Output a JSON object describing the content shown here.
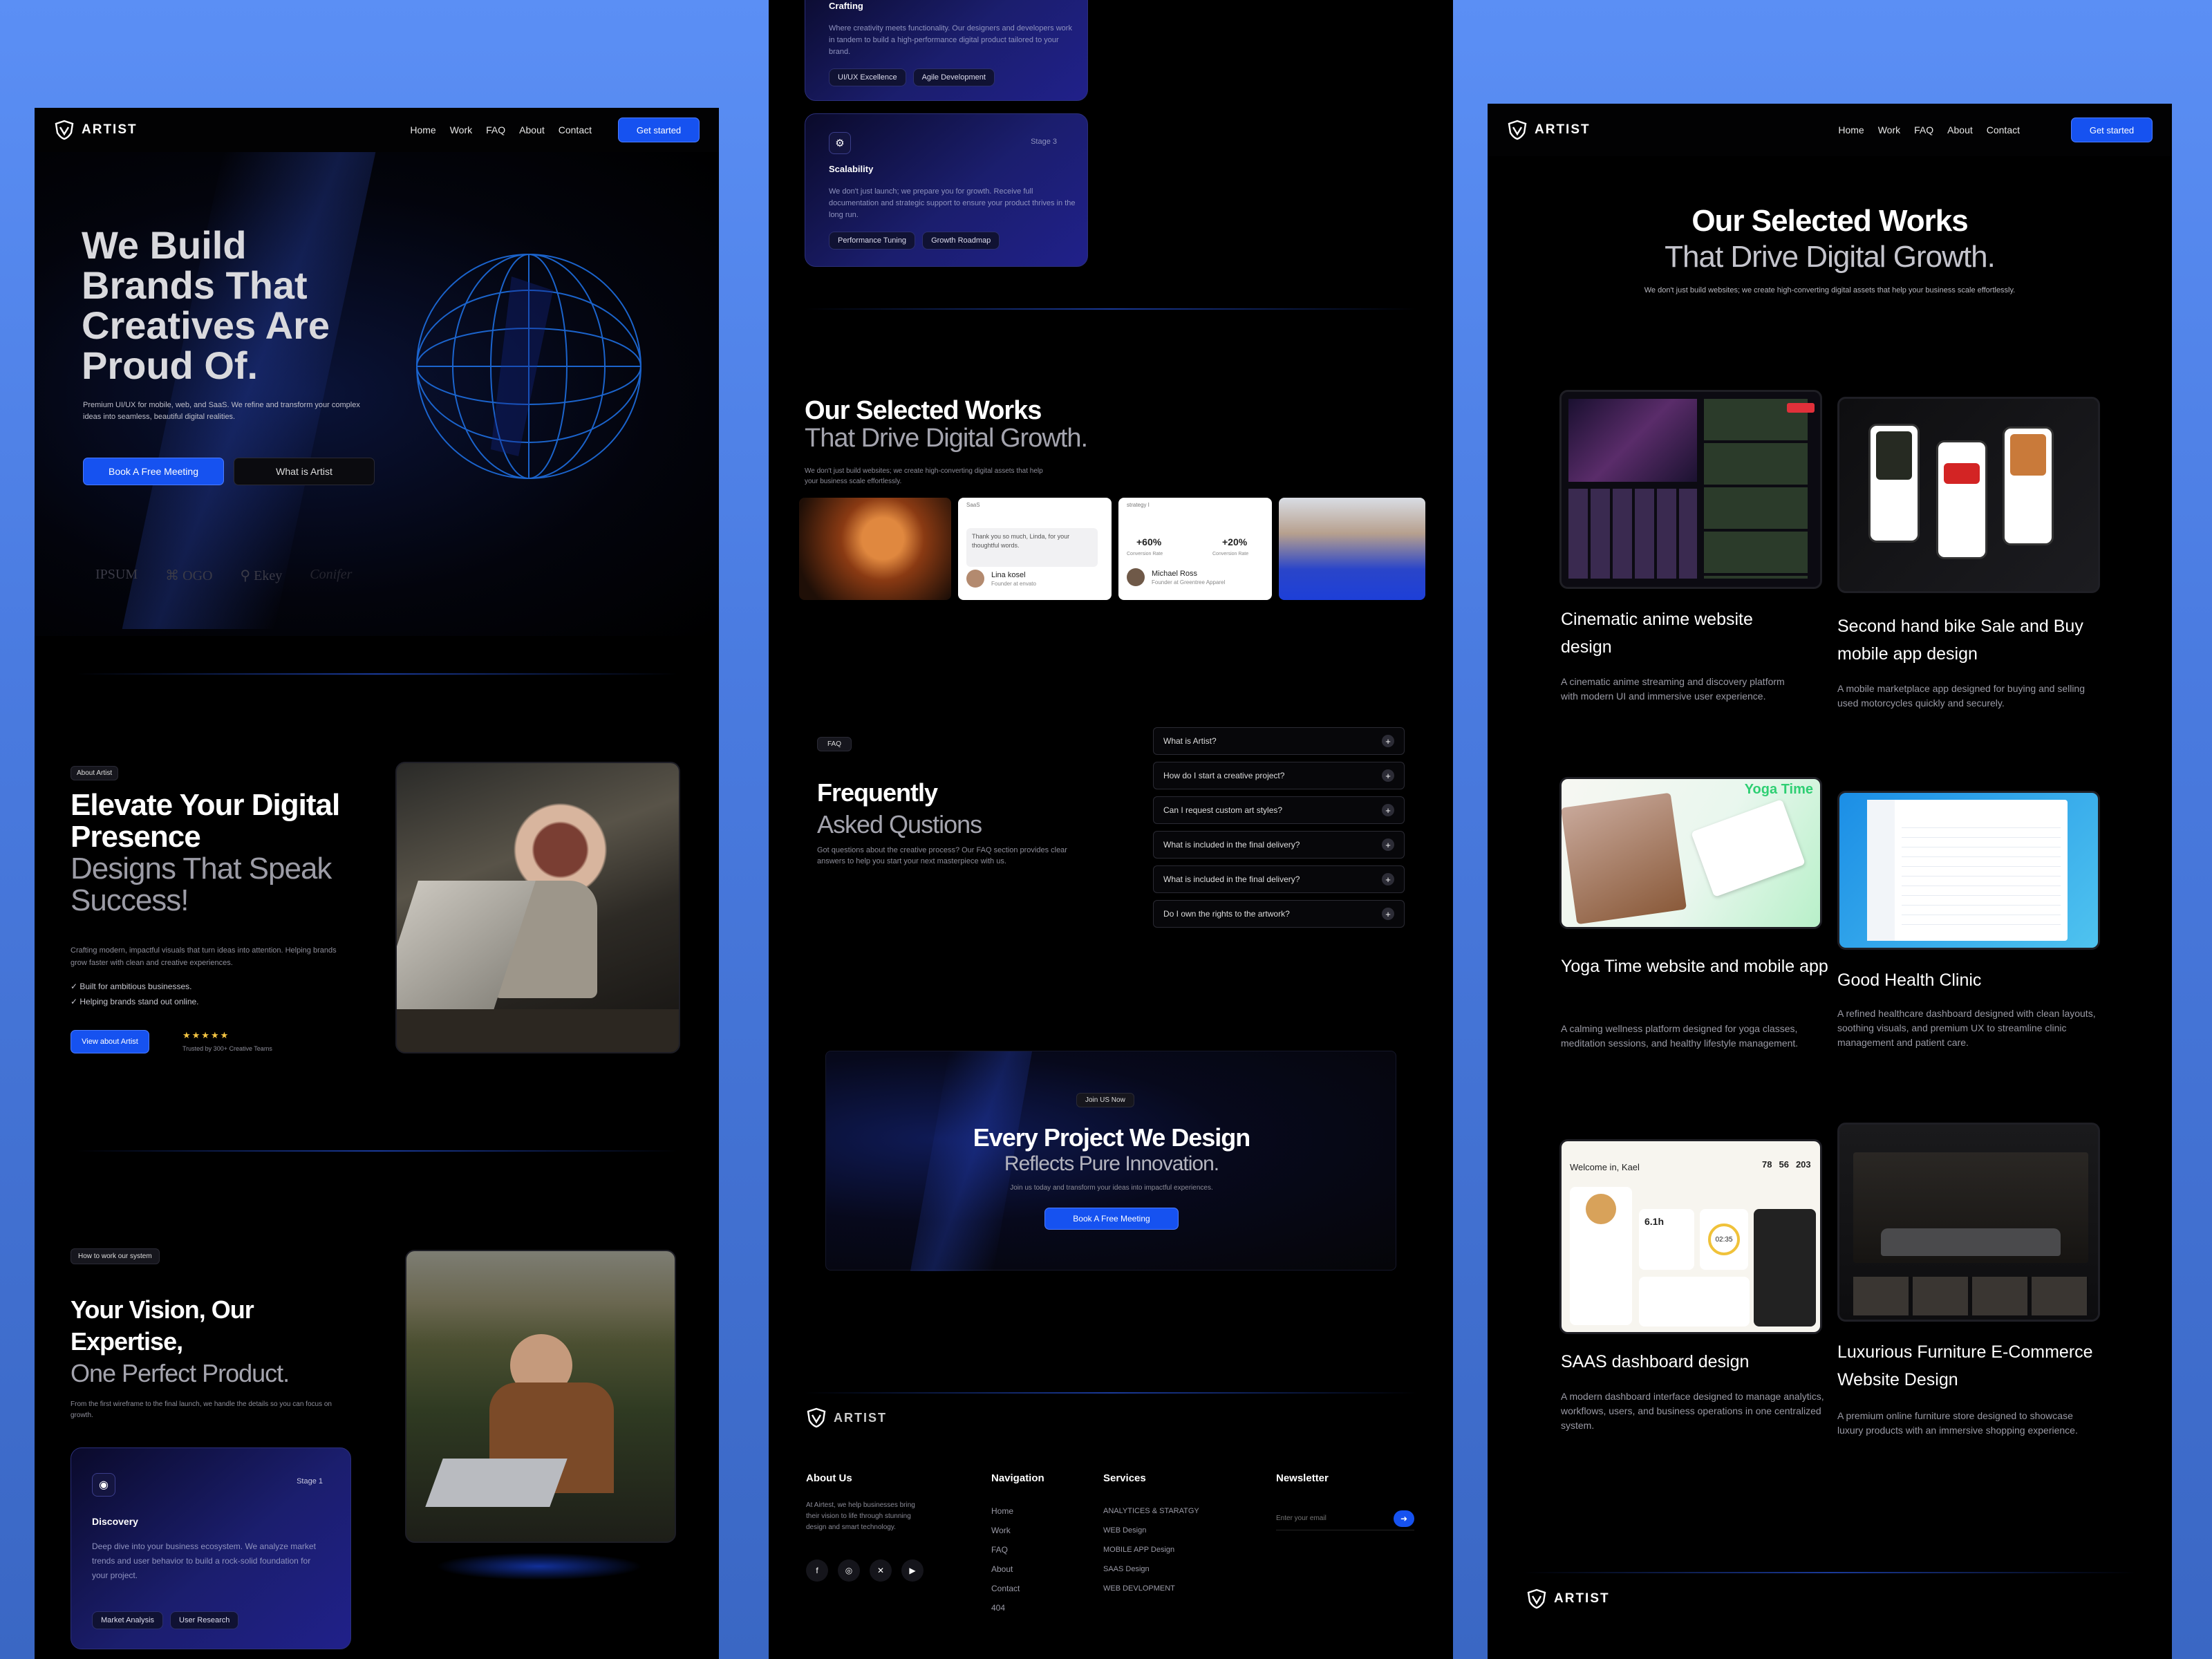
{
  "brand": "ARTIST",
  "nav": {
    "links": [
      "Home",
      "Work",
      "FAQ",
      "About",
      "Contact"
    ],
    "cta": "Get started"
  },
  "hero": {
    "title_lines": [
      "We Build",
      "Brands That",
      "Creatives Are",
      "Proud Of."
    ],
    "subtitle": "Premium UI/UX for mobile, web, and SaaS. We refine and transform your complex ideas into seamless, beautiful digital realities.",
    "btn_primary": "Book A Free Meeting",
    "btn_secondary": "What is Artist",
    "logos": [
      "IPSUM",
      "OGO",
      "Ekey"
    ]
  },
  "about": {
    "tag": "About Artist",
    "title1": "Elevate Your Digital",
    "title2": "Presence",
    "title3": "Designs That Speak",
    "title4": "Success!",
    "desc": "Crafting modern, impactful visuals that turn ideas into attention. Helping brands grow faster with clean and creative experiences.",
    "check1": "✓ Built for ambitious businesses.",
    "check2": "✓ Helping brands stand out online.",
    "btn": "View about Artist",
    "stars": "★★★★★",
    "trusted": "Trusted by 300+ Creative Teams"
  },
  "process": {
    "tag": "How to work our system",
    "title1": "Your Vision, Our",
    "title2": "Expertise,",
    "title3": "One Perfect Product.",
    "desc": "From the first wireframe to the final launch, we handle the details so you can focus on growth.",
    "card": {
      "stage": "Stage 1",
      "name": "Discovery",
      "desc": "Deep dive into your business ecosystem. We analyze market trends and user behavior to build a rock-solid foundation for your project.",
      "chips": [
        "Market Analysis",
        "User Research"
      ]
    }
  },
  "stage2": {
    "name": "Crafting",
    "desc": "Where creativity meets functionality. Our designers and developers work in tandem to build a high-performance digital product tailored to your brand.",
    "chips": [
      "UI/UX Excellence",
      "Agile Development"
    ]
  },
  "stage3": {
    "stage": "Stage 3",
    "name": "Scalability",
    "desc": "We don't just launch; we prepare you for growth. Receive full documentation and strategic support to ensure your product thrives in the long run.",
    "chips": [
      "Performance Tuning",
      "Growth Roadmap"
    ]
  },
  "works_mid": {
    "title1": "Our Selected Works",
    "title2": "That Drive Digital Growth.",
    "desc": "We don't just build websites; we create high-converting digital assets that help your business scale effortlessly.",
    "t1": "Thank you so much, Linda, for your thoughtful words.",
    "n1": "Lina kosel",
    "r1": "Founder at envato",
    "s1a": "+60%",
    "s1b": "+20%",
    "l1a": "Conversion Rate",
    "l1b": "Conversion Rate",
    "n2": "Michael Ross",
    "r2": "Founder at Greentree Apparel",
    "small1": "SaaS",
    "small2": "strategy I"
  },
  "faq": {
    "tag": "FAQ",
    "title1": "Frequently",
    "title2": "Asked Qustions",
    "desc": "Got questions about the creative process? Our FAQ section provides clear answers to help you start your next masterpiece with us.",
    "items": [
      "What is Artist?",
      "How do I start a creative project?",
      "Can I request custom art styles?",
      "What is included in the final delivery?",
      "What is included in the final delivery?",
      "Do I own the rights to the artwork?"
    ]
  },
  "cta": {
    "tag": "Join US Now",
    "title1": "Every Project We Design",
    "title2": "Reflects Pure Innovation.",
    "desc": "Join us today and transform your ideas into impactful experiences.",
    "btn": "Book A Free Meeting"
  },
  "footer": {
    "about_h": "About Us",
    "about": "At Airtest, we help businesses bring their vision to life through stunning design and smart technology.",
    "nav_h": "Navigation",
    "nav": [
      "Home",
      "Work",
      "FAQ",
      "About",
      "Contact",
      "404"
    ],
    "serv_h": "Services",
    "serv": [
      "ANALYTICES & STARATGY",
      "WEB Design",
      "MOBILE APP Design",
      "SAAS Design",
      "WEB DEVLOPMENT"
    ],
    "news_h": "Newsletter",
    "news_ph": "Enter your email"
  },
  "works": {
    "title1": "Our Selected Works",
    "title2": "That Drive Digital Growth.",
    "desc": "We don't just build websites; we create high-converting digital assets that help your business scale effortlessly.",
    "items": [
      {
        "title": "Cinematic anime website design",
        "desc": "A cinematic anime streaming and discovery platform with modern UI and immersive user experience."
      },
      {
        "title": "Second hand bike Sale and Buy mobile app design",
        "desc": "A mobile marketplace app designed for buying and selling used motorcycles quickly and securely."
      },
      {
        "title": "Yoga Time website and mobile app",
        "desc": "A calming wellness platform designed for yoga classes, meditation sessions, and healthy lifestyle management."
      },
      {
        "title": "Good Health Clinic",
        "desc": "A refined healthcare dashboard designed with clean layouts, soothing visuals, and premium UX to streamline clinic management and patient care."
      },
      {
        "title": "SAAS  dashboard design",
        "desc": "A modern dashboard interface designed to manage analytics, workflows, users, and business operations in one centralized system."
      },
      {
        "title": "Luxurious Furniture E-Commerce Website Design",
        "desc": "A premium online furniture store designed to showcase luxury products with an immersive shopping experience."
      }
    ]
  },
  "yoga_label": "Yoga Time",
  "dash": {
    "welcome": "Welcome in, Kael",
    "n1": "78",
    "n2": "56",
    "n3": "203",
    "time": "02:35",
    "hours": "6.1h"
  }
}
